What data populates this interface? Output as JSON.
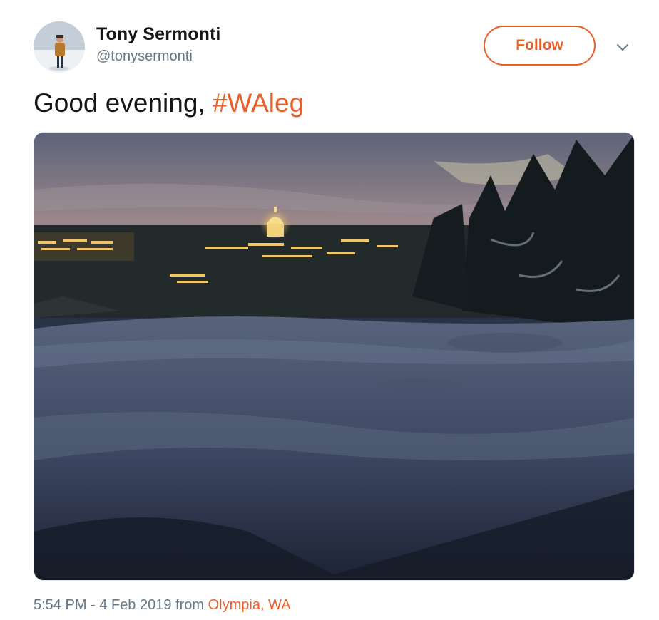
{
  "user": {
    "name": "Tony Sermonti",
    "handle": "@tonysermonti",
    "avatar_icon": "profile-photo-icon"
  },
  "actions": {
    "follow_label": "Follow",
    "menu_icon": "chevron-down-icon"
  },
  "tweet": {
    "text_prefix": "Good evening, ",
    "hashtag": "#WAleg"
  },
  "media": {
    "type": "photo",
    "icon": "photo-icon"
  },
  "meta": {
    "time": "5:54 PM",
    "separator": " - ",
    "date": "4 Feb 2019",
    "from_label": " from ",
    "place": "Olympia, WA"
  },
  "colors": {
    "accent": "#e95f2a",
    "text": "#14171a",
    "secondary": "#657786"
  }
}
